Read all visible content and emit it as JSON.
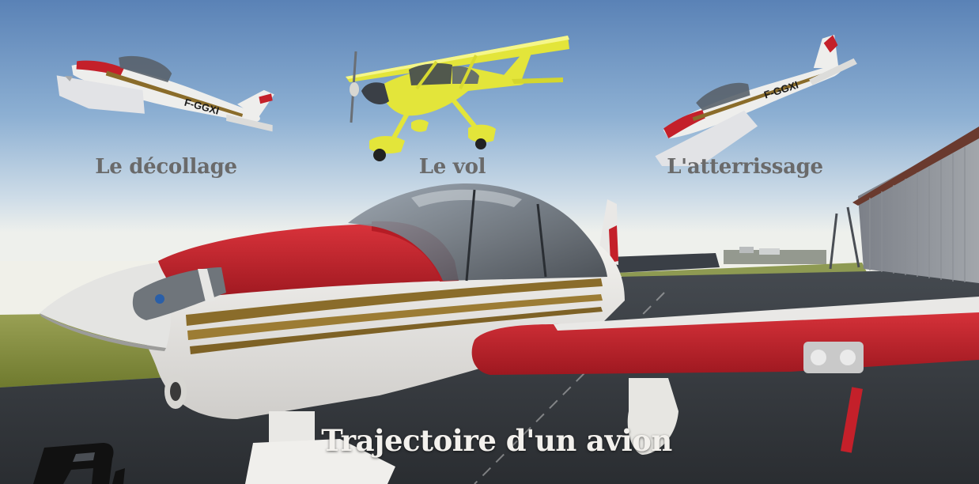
{
  "phases": [
    {
      "id": "takeoff",
      "label": "Le décollage",
      "registration": "F-GGXI"
    },
    {
      "id": "flight",
      "label": "Le vol",
      "registration": ""
    },
    {
      "id": "landing",
      "label": "L'atterrissage",
      "registration": "F-GGXI"
    }
  ],
  "main_title": "Trajectoire d'un avion",
  "hero_aircraft_registration": "F-GGXI",
  "colors": {
    "sky_top": "#5a82b6",
    "sky_bottom": "#e9edf0",
    "aircraft_red": "#c4202a",
    "aircraft_white": "#ecebe8",
    "stripe_gold": "#8a6c2a",
    "ultralight_yellow": "#e3e53a",
    "label_gray": "#6a6a6a",
    "title_white": "#f3f1ed"
  },
  "icons": {
    "logo": "corner-logo-icon"
  }
}
